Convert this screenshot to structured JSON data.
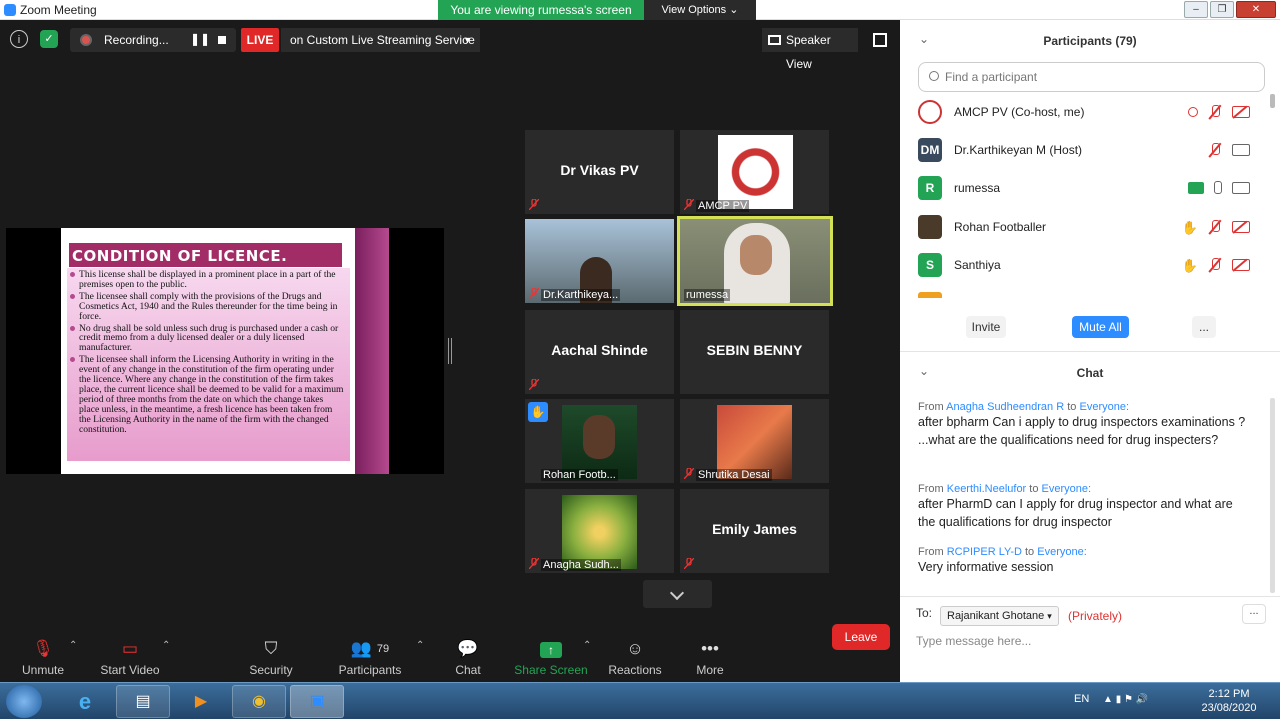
{
  "window": {
    "title": "Zoom Meeting",
    "viewing_banner": "You are viewing rumessa's screen",
    "view_options": "View Options"
  },
  "topbar": {
    "recording_label": "Recording...",
    "live_badge": "LIVE",
    "live_service": "on Custom Live Streaming Service",
    "speaker_view": "Speaker View"
  },
  "slide": {
    "title": "CONDITION OF LICENCE.",
    "bullets": [
      "This license shall be displayed in a prominent place in a part of the premises open to the public.",
      " The licensee shall comply with the provisions of the Drugs and Cosmetics Act, 1940 and the Rules thereunder for the time being in force.",
      "No drug shall be sold unless such drug is purchased under a cash or credit memo from a duly licensed dealer or a duly licensed manufacturer.",
      "The licensee shall inform the Licensing Authority in writing in the event of any change in the constitution of the firm operating under the licence. Where any change in the constitution of the firm takes place, the current licence shall be deemed to be valid for a maximum period of three months from the date on which the change takes place unless, in the meantime, a fresh licence has been taken from the Licensing Authority in the name of the firm with the changed constitution."
    ]
  },
  "gallery": [
    {
      "name": "Dr Vikas PV"
    },
    {
      "name": "AMCP PV"
    },
    {
      "name": "Dr.Karthikeya..."
    },
    {
      "name": "rumessa"
    },
    {
      "name": "Aachal Shinde"
    },
    {
      "name": "SEBIN BENNY"
    },
    {
      "name": "Rohan Footb..."
    },
    {
      "name": "Shrutika Desai"
    },
    {
      "name": "Anagha Sudh..."
    },
    {
      "name": "Emily James"
    }
  ],
  "toolbar": {
    "unmute": "Unmute",
    "start_video": "Start Video",
    "security": "Security",
    "participants": "Participants",
    "participants_count": "79",
    "chat": "Chat",
    "share_screen": "Share Screen",
    "reactions": "Reactions",
    "more": "More",
    "more_icon": "•••",
    "leave": "Leave"
  },
  "participants_panel": {
    "title": "Participants (79)",
    "search_placeholder": "Find a participant",
    "list": [
      {
        "avatar": "",
        "name": "AMCP PV (Co-host, me)",
        "color": "#ffffff"
      },
      {
        "avatar": "DM",
        "name": "Dr.Karthikeyan M (Host)",
        "color": "#3a4a5e"
      },
      {
        "avatar": "R",
        "name": "rumessa",
        "color": "#23a455"
      },
      {
        "avatar": "",
        "name": "Rohan Footballer",
        "color": "#4a3a2a"
      },
      {
        "avatar": "S",
        "name": "Santhiya",
        "color": "#23a455"
      }
    ],
    "invite": "Invite",
    "mute_all": "Mute All",
    "more": "..."
  },
  "chat_panel": {
    "title": "Chat",
    "messages": [
      {
        "from": "Anagha Sudheendran R",
        "to": "Everyone:",
        "text": "after bpharm  Can i apply to drug inspectors examinations ? ...what are the qualifications need for drug inspecters?"
      },
      {
        "from": "Keerthi.Neelufor",
        "to": "Everyone:",
        "text": "after PharmD can I apply for drug inspector and what are the qualifications for drug inspector"
      },
      {
        "from": "RCPIPER LY-D",
        "to": "Everyone:",
        "text": "Very informative session"
      }
    ],
    "from_word": "From",
    "to_word": "to",
    "to_label": "To:",
    "recipient": "Rajanikant Ghotane",
    "privately": "(Privately)",
    "placeholder": "Type message here...",
    "more": "..."
  },
  "taskbar": {
    "lang": "EN",
    "time": "2:12 PM",
    "date": "23/08/2020"
  },
  "colors": {
    "accent": "#2d8cff",
    "live": "#e02828",
    "green": "#23a455",
    "slide_title": "#a22c66"
  }
}
